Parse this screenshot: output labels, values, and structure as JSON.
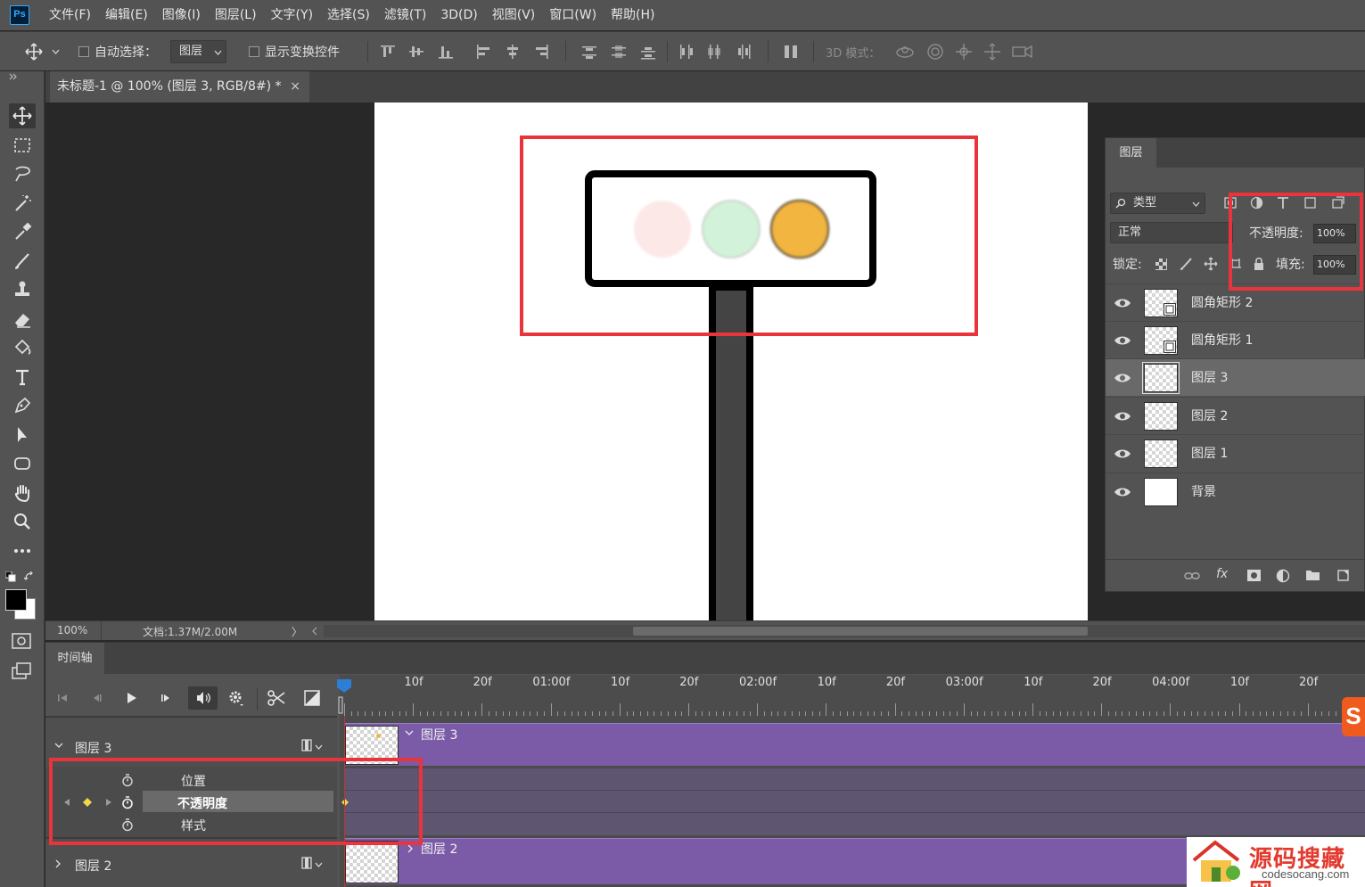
{
  "app": {
    "logo": "Ps"
  },
  "menu": [
    "文件(F)",
    "编辑(E)",
    "图像(I)",
    "图层(L)",
    "文字(Y)",
    "选择(S)",
    "滤镜(T)",
    "3D(D)",
    "视图(V)",
    "窗口(W)",
    "帮助(H)"
  ],
  "options": {
    "auto_select_label": "自动选择：",
    "auto_select_value": "图层",
    "show_transform_label": "显示变换控件",
    "mode_3d_label": "3D 模式："
  },
  "document": {
    "tab_title": "未标题-1 @ 100% (图层 3, RGB/8#) *",
    "close": "×",
    "zoom": "100%",
    "doc_size": "文档:1.37M/2.00M",
    "status_arrow": "〉"
  },
  "traffic_light": {
    "lights": [
      {
        "name": "red",
        "color": "#fde8e8"
      },
      {
        "name": "green",
        "color": "#d2f2d9"
      },
      {
        "name": "yellow",
        "color": "#f1b540"
      }
    ],
    "frame_color": "#000000",
    "pole_color": "#444444"
  },
  "layers_panel": {
    "tab": "图层",
    "filter_label": "类型",
    "blend_mode": "正常",
    "opacity_label": "不透明度:",
    "opacity_value": "100%",
    "lock_label": "锁定:",
    "fill_label": "填充:",
    "fill_value": "100%",
    "layers": [
      {
        "name": "圆角矩形 2",
        "selected": false
      },
      {
        "name": "圆角矩形 1",
        "selected": false
      },
      {
        "name": "图层 3",
        "selected": true
      },
      {
        "name": "图层 2",
        "selected": false
      },
      {
        "name": "图层 1",
        "selected": false
      },
      {
        "name": "背景",
        "selected": false
      }
    ]
  },
  "timeline": {
    "tab": "时间轴",
    "ruler_labels": [
      "10f",
      "20f",
      "01:00f",
      "10f",
      "20f",
      "02:00f",
      "10f",
      "20f",
      "03:00f",
      "10f",
      "20f",
      "04:00f",
      "10f",
      "20f"
    ],
    "layer3_track": "图层 3",
    "layer2_track": "图层 2",
    "properties": [
      "位置",
      "不透明度",
      "样式"
    ],
    "clip_layer3": "图层 3",
    "clip_layer2": "图层 2"
  },
  "watermark": {
    "title": "源码搜藏网",
    "url": "codesocang.com"
  },
  "colors": {
    "accent_red": "#e8343a",
    "clip_purple": "#7b5ba8",
    "panel_bg": "#535353"
  }
}
